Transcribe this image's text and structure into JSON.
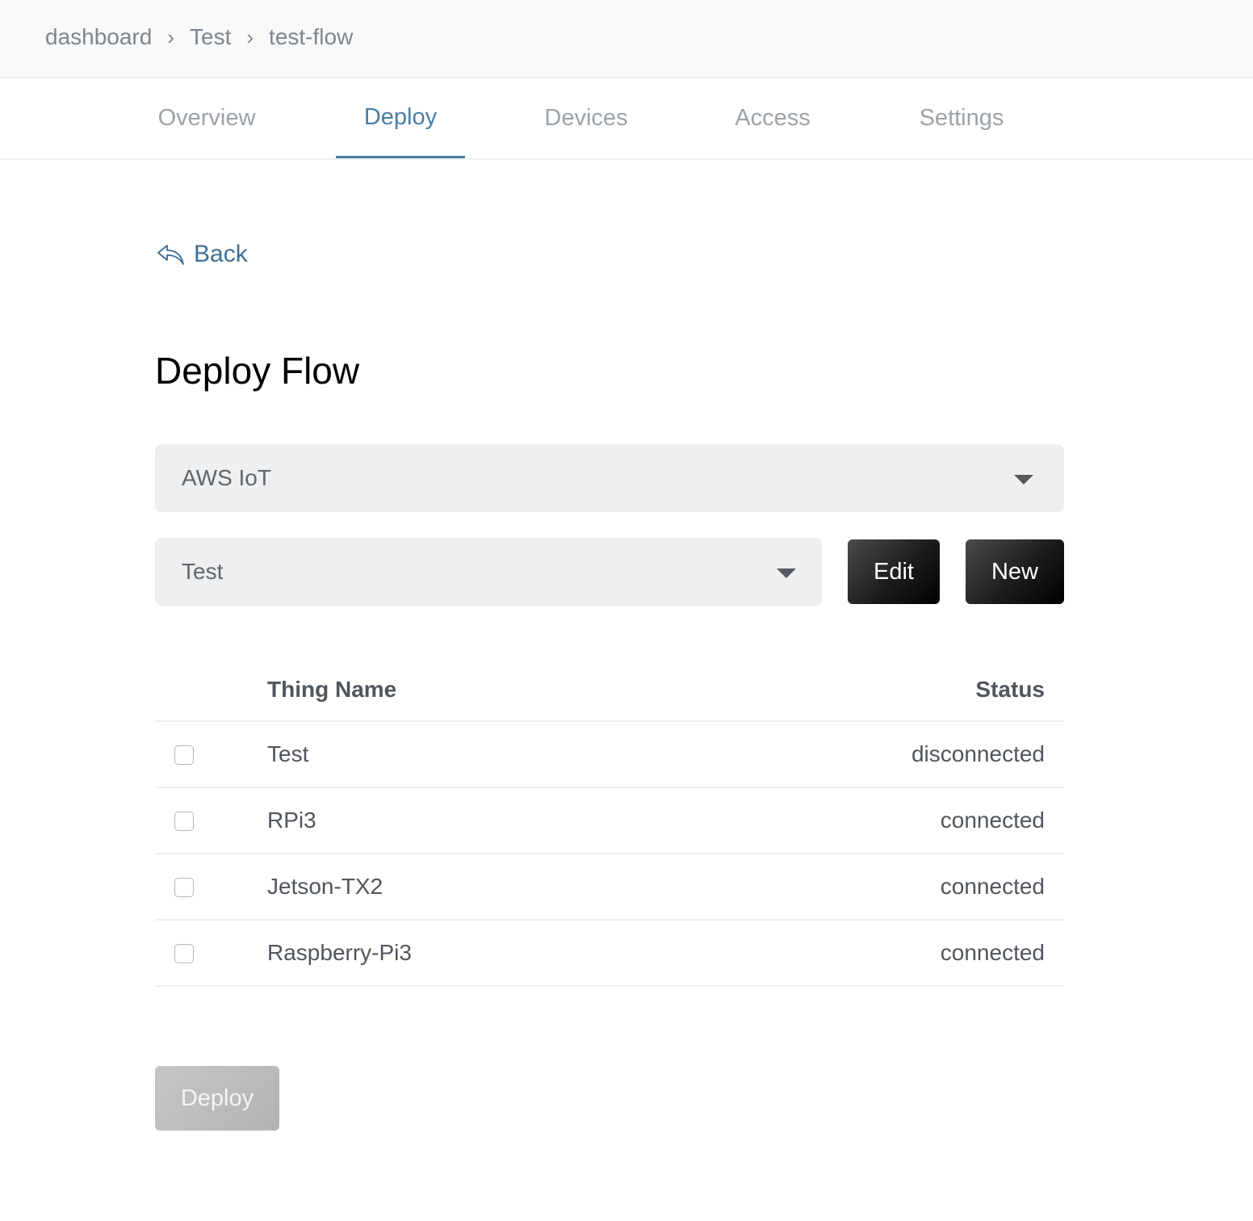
{
  "breadcrumb": {
    "items": [
      "dashboard",
      "Test",
      "test-flow"
    ],
    "separator": "›"
  },
  "tabs": [
    {
      "label": "Overview",
      "active": false
    },
    {
      "label": "Deploy",
      "active": true
    },
    {
      "label": "Devices",
      "active": false
    },
    {
      "label": "Access",
      "active": false
    },
    {
      "label": "Settings",
      "active": false
    }
  ],
  "back": {
    "label": "Back",
    "icon": "reply-arrow-icon"
  },
  "page_title": "Deploy Flow",
  "platform_select": {
    "value": "AWS IoT",
    "icon": "caret-down-icon"
  },
  "config_select": {
    "value": "Test",
    "icon": "caret-down-icon"
  },
  "buttons": {
    "edit": "Edit",
    "new": "New",
    "deploy": "Deploy"
  },
  "table": {
    "columns": [
      "Thing Name",
      "Status"
    ],
    "rows": [
      {
        "name": "Test",
        "status": "disconnected",
        "checked": false
      },
      {
        "name": "RPi3",
        "status": "connected",
        "checked": false
      },
      {
        "name": "Jetson-TX2",
        "status": "connected",
        "checked": false
      },
      {
        "name": "Raspberry-Pi3",
        "status": "connected",
        "checked": false
      }
    ]
  },
  "colors": {
    "accent": "#4a7ea3",
    "tab_inactive": "#9ba3aa",
    "select_bg": "#eeeff1",
    "dark_button": "#1c1c1c",
    "disabled_button": "#bdbdbd"
  }
}
